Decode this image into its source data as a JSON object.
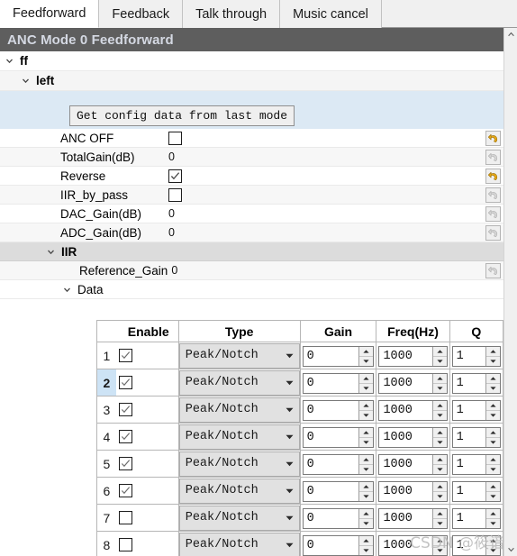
{
  "tabs": [
    {
      "label": "Feedforward",
      "active": true
    },
    {
      "label": "Feedback",
      "active": false
    },
    {
      "label": "Talk through",
      "active": false
    },
    {
      "label": "Music cancel",
      "active": false
    }
  ],
  "title": "ANC Mode 0 Feedforward",
  "tree": {
    "root_label": "ff",
    "child_label": "left",
    "iir_label": "IIR",
    "data_label": "Data"
  },
  "get_config_button": "Get config data from last mode",
  "properties": [
    {
      "label": "ANC OFF",
      "value": "",
      "type": "checkbox",
      "checked": false,
      "revert": "active"
    },
    {
      "label": "TotalGain(dB)",
      "value": "0",
      "type": "text",
      "checked": false,
      "revert": "disabled"
    },
    {
      "label": "Reverse",
      "value": "",
      "type": "checkbox",
      "checked": true,
      "revert": "active"
    },
    {
      "label": "IIR_by_pass",
      "value": "",
      "type": "checkbox",
      "checked": false,
      "revert": "disabled"
    },
    {
      "label": "DAC_Gain(dB)",
      "value": "0",
      "type": "text",
      "checked": false,
      "revert": "disabled"
    },
    {
      "label": "ADC_Gain(dB)",
      "value": "0",
      "type": "text",
      "checked": false,
      "revert": "disabled"
    }
  ],
  "reference_gain": {
    "label": "Reference_Gain",
    "value": "0",
    "revert": "disabled"
  },
  "table": {
    "columns": [
      "",
      "Enable",
      "Type",
      "Gain",
      "Freq(Hz)",
      "Q"
    ],
    "selected_row": 2,
    "rows": [
      {
        "num": "1",
        "enabled": true,
        "type": "Peak/Notch",
        "gain": "0",
        "freq": "1000",
        "q": "1"
      },
      {
        "num": "2",
        "enabled": true,
        "type": "Peak/Notch",
        "gain": "0",
        "freq": "1000",
        "q": "1"
      },
      {
        "num": "3",
        "enabled": true,
        "type": "Peak/Notch",
        "gain": "0",
        "freq": "1000",
        "q": "1"
      },
      {
        "num": "4",
        "enabled": true,
        "type": "Peak/Notch",
        "gain": "0",
        "freq": "1000",
        "q": "1"
      },
      {
        "num": "5",
        "enabled": true,
        "type": "Peak/Notch",
        "gain": "0",
        "freq": "1000",
        "q": "1"
      },
      {
        "num": "6",
        "enabled": true,
        "type": "Peak/Notch",
        "gain": "0",
        "freq": "1000",
        "q": "1"
      },
      {
        "num": "7",
        "enabled": false,
        "type": "Peak/Notch",
        "gain": "0",
        "freq": "1000",
        "q": "1"
      },
      {
        "num": "8",
        "enabled": false,
        "type": "Peak/Notch",
        "gain": "0",
        "freq": "1000",
        "q": "1"
      }
    ]
  },
  "watermark": "CSDN @筱谙",
  "colors": {
    "title_bar": "#5e5e5e",
    "title_text": "#d4d8e2",
    "selection": "#cde3f5",
    "group_header": "#dcdcdc",
    "button_row": "#dce9f4",
    "revert_active": "#e8a917"
  }
}
